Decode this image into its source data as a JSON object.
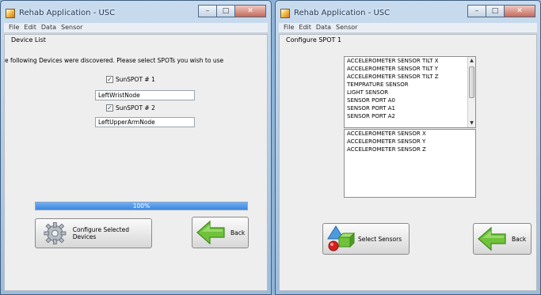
{
  "window1": {
    "title": "Rehab Application - USC",
    "menu": [
      "File",
      "Edit",
      "Data",
      "Sensor"
    ],
    "heading": "Device List",
    "message": "e following Devices were discovered. Please select SPOTs you wish to use",
    "devices": [
      {
        "label": "SunSPOT # 1",
        "checked": true,
        "name": "LeftWristNode"
      },
      {
        "label": "SunSPOT # 2",
        "checked": true,
        "name": "LeftUpperArmNode"
      }
    ],
    "progress_text": "100%",
    "progress_value": 1.0,
    "configure_label": "Configure Selected Devices",
    "back_label": "Back"
  },
  "window2": {
    "title": "Rehab Application - USC",
    "menu": [
      "File",
      "Edit",
      "Data",
      "Sensor"
    ],
    "heading": "Configure SPOT 1",
    "sensor_list": [
      "ACCELEROMETER SENSOR TILT X",
      "ACCELEROMETER SENSOR TILT Y",
      "ACCELEROMETER SENSOR TILT Z",
      "TEMPRATURE SENSOR",
      "LIGHT SENSOR",
      "SENSOR PORT A0",
      "SENSOR PORT A1",
      "SENSOR PORT A2"
    ],
    "selected_list": [
      "ACCELEROMETER SENSOR X",
      "ACCELEROMETER SENSOR Y",
      "ACCELEROMETER SENSOR Z"
    ],
    "select_label": "Select Sensors",
    "back_label": "Back"
  },
  "icons": {
    "app": "java-cup-icon",
    "minimize": "minimize-icon",
    "maximize": "maximize-icon",
    "close": "close-icon",
    "gear": "gear-icon",
    "back": "green-left-arrow-icon",
    "sensors": "shapes-icon"
  },
  "colors": {
    "progress": "#3c86de",
    "back_arrow": "#6fc23a",
    "title_text": "#233b55"
  }
}
